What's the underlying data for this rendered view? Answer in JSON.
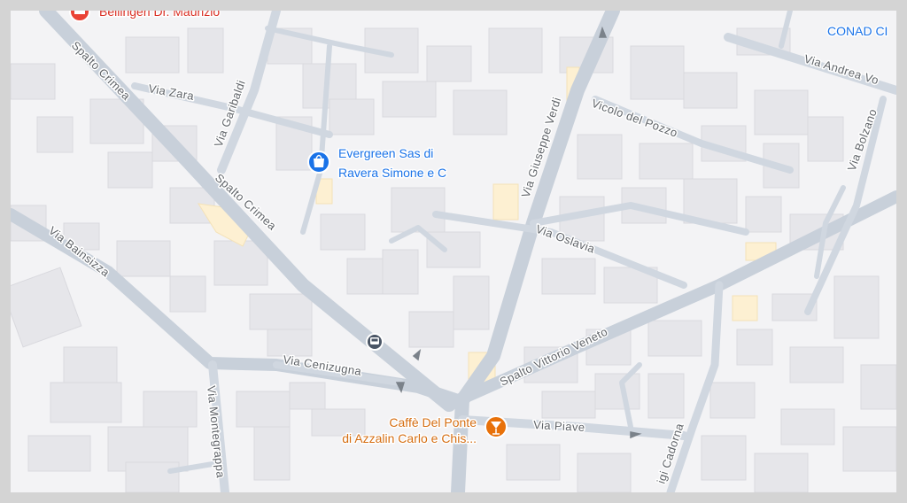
{
  "map": {
    "streets": {
      "spalto_crimea_north": "Spalto Crimea",
      "spalto_crimea_south": "Spalto Crimea",
      "via_zara": "Via Zara",
      "via_garibaldi": "Via Garibaldi",
      "via_giuseppe_verdi": "Via Giuseppe Verdi",
      "vicolo_del_pozzo": "Vicolo del Pozzo",
      "via_andrea": "Via Andrea Vo",
      "via_bolzano": "Via Bolzano",
      "via_oslavia": "Via Oslavia",
      "via_bainsizza": "Via Bainsizza",
      "spalto_vittorio_veneto": "Spalto Vittorio Veneto",
      "via_cenizugna": "Via Cenizugna",
      "via_piave": "Via Piave",
      "via_montegrappa": "Via Montegrappa",
      "via_cadorna": "igi Cadorna"
    },
    "pois": {
      "bellingeri": "Bellingeri Dr. Maurizio",
      "evergreen_line1": "Evergreen Sas di",
      "evergreen_line2": "Ravera Simone e C",
      "caffe_line1": "Caffè Del Ponte",
      "caffe_line2": "di Azzalin Carlo e Chis...",
      "conad": "CONAD CI"
    },
    "icons": {
      "evergreen": "shopping-bag-icon",
      "caffe": "cocktail-icon",
      "bellingeri": "medical-icon",
      "bus_stop": "bus-stop-icon"
    },
    "colors": {
      "background": "#f3f3f5",
      "road": "#c8d0da",
      "building": "#e6e6ea",
      "poi_blue": "#1a73e8",
      "poi_orange": "#e8710a",
      "poi_red": "#d93025"
    }
  }
}
